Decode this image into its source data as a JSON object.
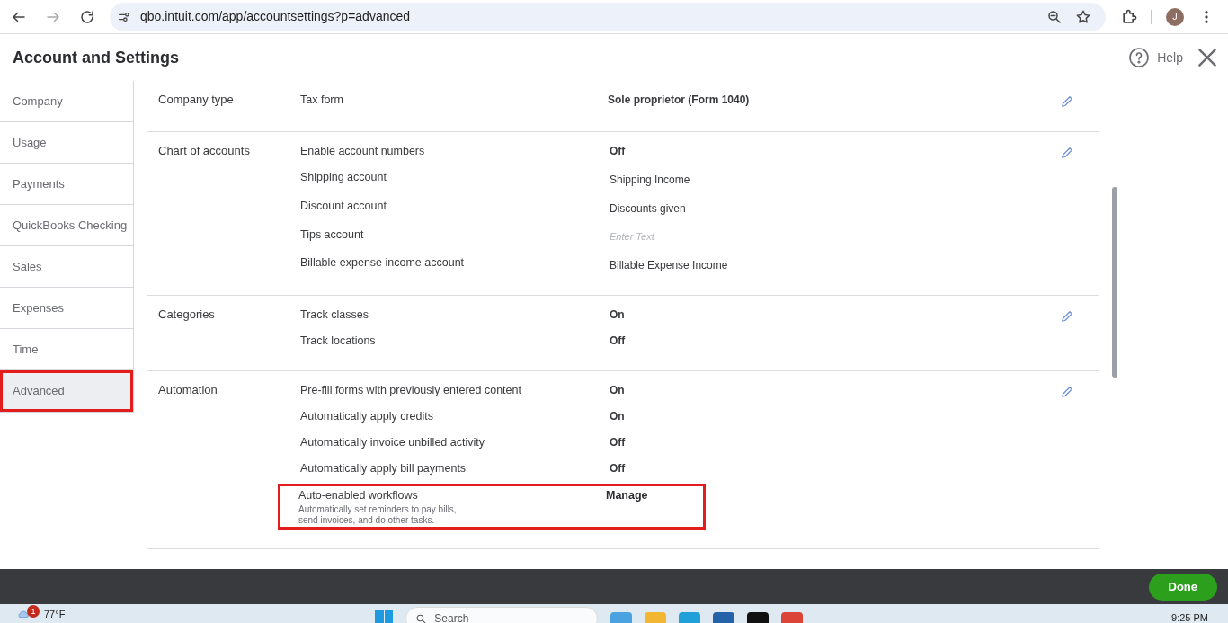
{
  "browser": {
    "url": "qbo.intuit.com/app/accountsettings?p=advanced",
    "profile_initial": "J"
  },
  "header": {
    "title": "Account and Settings",
    "help": "Help"
  },
  "sidebar": {
    "items": [
      {
        "label": "Company",
        "selected": false,
        "highlighted": false
      },
      {
        "label": "Usage",
        "selected": false,
        "highlighted": false
      },
      {
        "label": "Payments",
        "selected": false,
        "highlighted": false
      },
      {
        "label": "QuickBooks Checking",
        "selected": false,
        "highlighted": false
      },
      {
        "label": "Sales",
        "selected": false,
        "highlighted": false
      },
      {
        "label": "Expenses",
        "selected": false,
        "highlighted": false
      },
      {
        "label": "Time",
        "selected": false,
        "highlighted": false
      },
      {
        "label": "Advanced",
        "selected": true,
        "highlighted": true
      }
    ]
  },
  "sections": [
    {
      "title": "Company type",
      "rows": [
        {
          "kind": "bold",
          "label": "Tax form",
          "value": "Sole proprietor (Form 1040)"
        }
      ]
    },
    {
      "title": "Chart of accounts",
      "rows": [
        {
          "kind": "setting",
          "label": "Enable account numbers",
          "value": "Off"
        },
        {
          "kind": "plain",
          "label": "Shipping account",
          "value": "Shipping Income"
        },
        {
          "kind": "plain",
          "label": "Discount account",
          "value": "Discounts given"
        },
        {
          "kind": "field",
          "label": "Tips account",
          "placeholder": "Enter Text"
        },
        {
          "kind": "plain",
          "label": "Billable expense income account",
          "value": "Billable Expense Income"
        }
      ]
    },
    {
      "title": "Categories",
      "rows": [
        {
          "kind": "setting",
          "label": "Track classes",
          "value": "On"
        },
        {
          "kind": "setting",
          "label": "Track locations",
          "value": "Off"
        }
      ]
    },
    {
      "title": "Automation",
      "rows": [
        {
          "kind": "setting",
          "label": "Pre-fill forms with previously entered content",
          "value": "On"
        },
        {
          "kind": "setting",
          "label": "Automatically apply credits",
          "value": "On"
        },
        {
          "kind": "setting",
          "label": "Automatically invoice unbilled activity",
          "value": "Off"
        },
        {
          "kind": "setting",
          "label": "Automatically apply bill payments",
          "value": "Off"
        },
        {
          "kind": "action",
          "label": "Auto-enabled workflows",
          "description": "Automatically set reminders to pay bills,\nsend invoices, and do other tasks.",
          "value": "Manage",
          "highlighted": true
        }
      ]
    }
  ],
  "footer": {
    "done": "Done"
  },
  "taskbar": {
    "weather": "77°F",
    "weather_badge": "1",
    "search": "Search",
    "time": "9:25 PM"
  }
}
